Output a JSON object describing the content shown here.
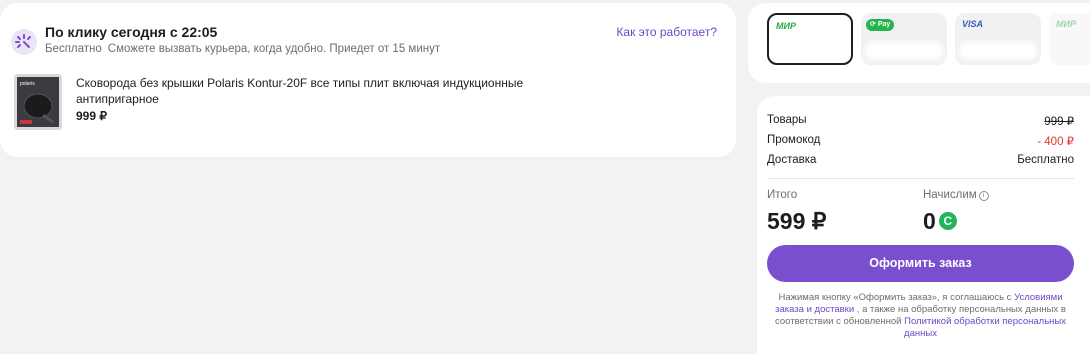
{
  "delivery": {
    "title": "По клику сегодня с 22:05",
    "free_label": "Бесплатно",
    "description": "Сможете вызвать курьера, когда удобно. Приедет от 15 минут",
    "how_link": "Как это работает?",
    "accent_color": "#6e46c8"
  },
  "product": {
    "name": "Сковорода без крышки Polaris Kontur-20F все типы плит включая индукционные антипригарное",
    "price": "999 ₽",
    "thumb_brand": "polaris"
  },
  "payment_methods": [
    {
      "label": "МИР",
      "active": true
    },
    {
      "label": "Pay",
      "active": false
    },
    {
      "label": "VISA",
      "active": false
    },
    {
      "label": "МИР",
      "active": false
    }
  ],
  "summary": {
    "goods_label": "Товары",
    "goods_value": "999 ₽",
    "promo_label": "Промокод",
    "promo_value": "- 400 ₽",
    "shipping_label": "Доставка",
    "shipping_value": "Бесплатно",
    "total_label": "Итого",
    "total_value": "599 ₽",
    "bonus_label": "Начислим",
    "bonus_value": "0",
    "bonus_icon": "С",
    "order_button": "Оформить заказ"
  },
  "legal": {
    "part1": "Нажимая кнопку «Оформить заказ», я соглашаюсь с ",
    "link1": "Условиями заказа и доставки",
    "part2": " , а также на обработку персональных данных в соответствии с обновленной ",
    "link2": "Политикой обработки персональных данных"
  }
}
